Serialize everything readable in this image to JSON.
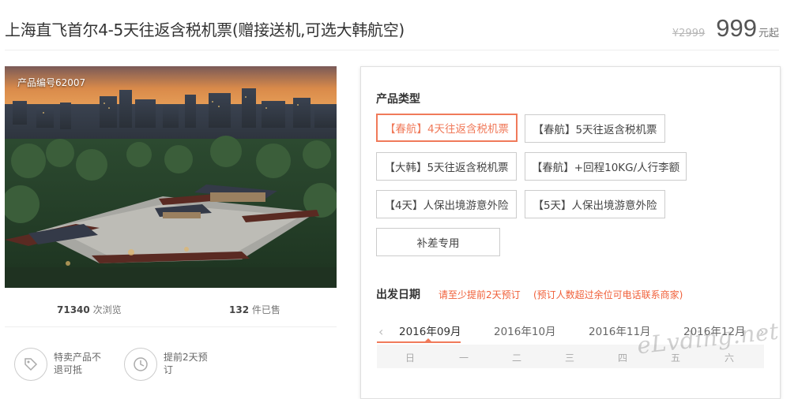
{
  "product": {
    "title": "上海直飞首尔4-5天往返含税机票(赠接送机,可选大韩航空)",
    "original_price": "¥2999",
    "price": "999",
    "price_unit": "元起",
    "product_id": "产品编号62007"
  },
  "stats": {
    "views_count": "71340",
    "views_label": "次浏览",
    "sold_count": "132",
    "sold_label": "件已售"
  },
  "features": [
    {
      "label": "特卖产品不退可抵",
      "icon": "tag-icon"
    },
    {
      "label": "提前2天预订",
      "icon": "clock-icon"
    }
  ],
  "product_type": {
    "title": "产品类型",
    "options": [
      {
        "label": "【春航】4天往返含税机票",
        "selected": true
      },
      {
        "label": "【春航】5天往返含税机票",
        "selected": false
      },
      {
        "label": "【大韩】5天往返含税机票",
        "selected": false
      },
      {
        "label": "【春航】+回程10KG/人行李额",
        "selected": false
      },
      {
        "label": "【4天】人保出境游意外险",
        "selected": false
      },
      {
        "label": "【5天】人保出境游意外险",
        "selected": false
      },
      {
        "label": "补差专用",
        "selected": false
      }
    ]
  },
  "departure": {
    "title": "出发日期",
    "note1": "请至少提前2天预订",
    "note2": "(预订人数超过余位可电话联系商家)",
    "months": [
      "2016年09月",
      "2016年10月",
      "2016年11月",
      "2016年12月"
    ],
    "active_month": 0,
    "prev_icon": "chevron-left-icon",
    "next_icon": "chevron-right-icon",
    "weekdays": [
      "日",
      "一",
      "二",
      "三",
      "四",
      "五",
      "六"
    ]
  },
  "watermark": "eLvding.net",
  "colors": {
    "accent": "#f07a5a",
    "note": "#f0603a"
  }
}
